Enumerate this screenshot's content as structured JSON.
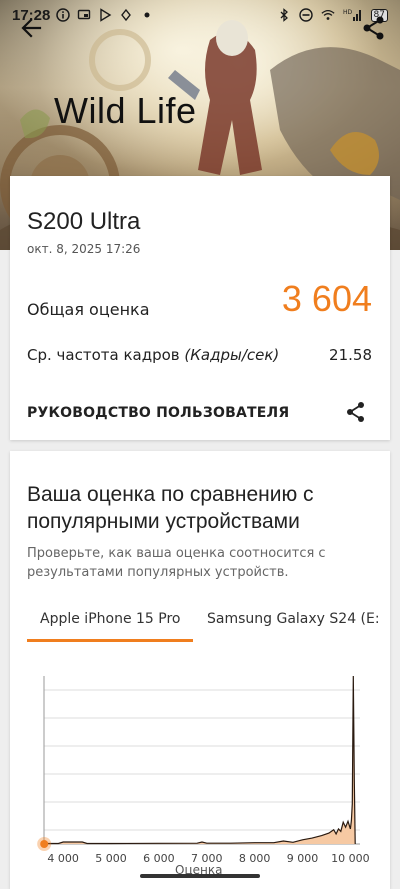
{
  "status_bar": {
    "time": "17:28",
    "battery": "87",
    "network": "HD",
    "icons_left": [
      "info-icon",
      "cast-icon",
      "play-store-icon",
      "location-icon",
      "dot-icon"
    ],
    "icons_right": [
      "bluetooth-icon",
      "do-not-disturb-icon",
      "wifi-icon",
      "signal-icon",
      "battery-icon"
    ]
  },
  "header": {
    "title": "Wild Life",
    "back_icon": "arrow-left-icon",
    "share_icon": "share-icon"
  },
  "result": {
    "device": "S200 Ultra",
    "date": "окт. 8, 2025 17:26",
    "score_label": "Общая оценка",
    "score_value": "3 604",
    "fps_label": "Ср. частота кадров",
    "fps_unit": "(Кадры/сек)",
    "fps_value": "21.58",
    "guide_label": "РУКОВОДСТВО ПОЛЬЗОВАТЕЛЯ"
  },
  "comparison": {
    "title": "Ваша оценка по сравнению с популярными устройствами",
    "subtitle": "Проверьте, как ваша оценка соотносится с результатами популярных устройств.",
    "tabs": [
      "Apple iPhone 15 Pro",
      "Samsung Galaxy S24 (E:"
    ],
    "active_tab": 0
  },
  "colors": {
    "accent": "#f07e1e",
    "histogram_fill": "#f6c9a3",
    "grid": "#dddddd"
  },
  "chart_data": {
    "type": "area",
    "xlabel": "Оценка",
    "ylabel": "",
    "xlim": [
      3600,
      10200
    ],
    "ticks": [
      4000,
      5000,
      6000,
      7000,
      8000,
      9000,
      10000
    ],
    "tick_labels": [
      "4 000",
      "5 000",
      "6 000",
      "7 000",
      "8 000",
      "9 000",
      "10 000"
    ],
    "marker_score": 3604,
    "series": [
      {
        "x": [
          3600,
          3900,
          4000,
          4400,
          4500,
          5000,
          6000,
          6800,
          6900,
          7000,
          7500,
          8000,
          8400,
          8600,
          8800,
          9000,
          9200,
          9400,
          9550,
          9650,
          9700,
          9750,
          9800,
          9850,
          9900,
          9950,
          10000,
          10020,
          10040,
          10060,
          10080,
          10100
        ],
        "y": [
          0.3,
          0.3,
          1.2,
          1.2,
          0.3,
          0.3,
          0.4,
          0.5,
          1.2,
          0.5,
          0.5,
          0.8,
          0.8,
          1.8,
          1.0,
          2.5,
          3.5,
          5.0,
          6.5,
          8.5,
          6.0,
          9.0,
          7.5,
          13.0,
          10.0,
          13.5,
          9.0,
          14.0,
          24.0,
          100.0,
          38.0,
          0.0
        ]
      }
    ],
    "ylim": [
      0,
      100
    ],
    "grid": true
  }
}
